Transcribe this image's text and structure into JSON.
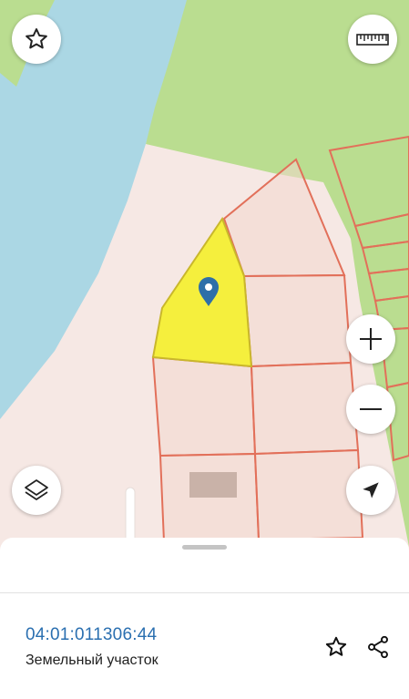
{
  "map": {
    "colors": {
      "water": "#abd7e4",
      "forest": "#badd90",
      "land": "#f6e8e4",
      "parcel_fill": "#f2d7cd",
      "parcel_border": "#e2705a",
      "selected_parcel": "#f5ef3d",
      "selected_border": "#c9b72c",
      "marker": "#2e6fa8",
      "building": "#c9b2a8"
    },
    "marker_icon": "map-pin-icon"
  },
  "controls": {
    "favorite_icon": "star-icon",
    "ruler_icon": "ruler-icon",
    "zoom_in_icon": "plus-icon",
    "zoom_out_icon": "minus-icon",
    "layers_icon": "layers-icon",
    "location_icon": "navigation-arrow-icon"
  },
  "info_panel": {
    "cadastral_number": "04:01:011306:44",
    "parcel_type": "Земельный участок",
    "star_icon": "star-outline-icon",
    "share_icon": "share-icon",
    "accent_color": "#2a6fb0"
  }
}
